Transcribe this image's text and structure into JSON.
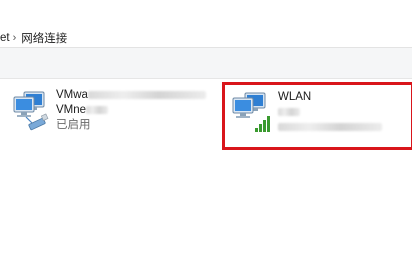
{
  "breadcrumb": {
    "parent_label": "et",
    "current_label": "网络连接"
  },
  "adapters": [
    {
      "name_line1": "VMwa",
      "name_line2": "VMne",
      "status": "已启用",
      "icon": "network-adapter-cable-icon"
    },
    {
      "name_line1": "WLAN",
      "icon": "network-adapter-wifi-icon",
      "highlight_color": "#d9151b"
    }
  ],
  "colors": {
    "highlight_border": "#d9151b",
    "wifi_signal": "#3a9a2f"
  }
}
